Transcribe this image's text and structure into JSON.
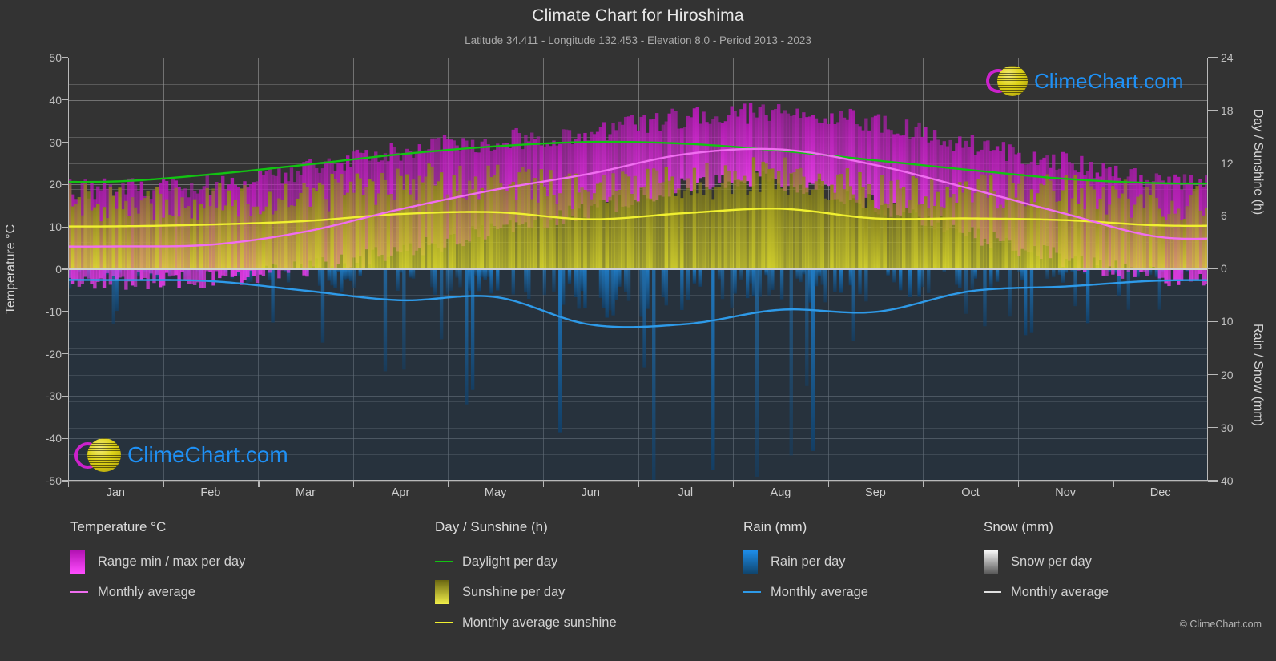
{
  "header": {
    "title": "Climate Chart for Hiroshima",
    "subtitle": "Latitude 34.411 - Longitude 132.453 - Elevation 8.0 - Period 2013 - 2023"
  },
  "branding": {
    "name": "ClimeChart.com",
    "copyright": "© ClimeChart.com",
    "ring_color": "#cc22cc",
    "ball_color": "#ded319",
    "text_color": "#1e90f5"
  },
  "axes": {
    "left_title": "Temperature °C",
    "right_title_top": "Day / Sunshine (h)",
    "right_title_bottom": "Rain / Snow (mm)",
    "left_ticks": [
      "50",
      "40",
      "30",
      "20",
      "10",
      "0",
      "-10",
      "-20",
      "-30",
      "-40",
      "-50"
    ],
    "right_ticks_top": [
      "24",
      "18",
      "12",
      "6",
      "0"
    ],
    "right_ticks_bottom": [
      "0",
      "10",
      "20",
      "30",
      "40"
    ],
    "x_ticks": [
      "Jan",
      "Feb",
      "Mar",
      "Apr",
      "May",
      "Jun",
      "Jul",
      "Aug",
      "Sep",
      "Oct",
      "Nov",
      "Dec"
    ]
  },
  "legend": {
    "groups": [
      {
        "title": "Temperature °C",
        "items": [
          {
            "label": "Range min / max per day",
            "type": "swatch",
            "color": "#e818e8"
          },
          {
            "label": "Monthly average",
            "type": "line",
            "color": "#f06ef0"
          }
        ]
      },
      {
        "title": "Day / Sunshine (h)",
        "items": [
          {
            "label": "Daylight per day",
            "type": "line",
            "color": "#12c312"
          },
          {
            "label": "Sunshine per day",
            "type": "swatch",
            "color": "#e8e830"
          },
          {
            "label": "Monthly average sunshine",
            "type": "line",
            "color": "#f0f030"
          }
        ]
      },
      {
        "title": "Rain (mm)",
        "items": [
          {
            "label": "Rain per day",
            "type": "swatch",
            "color": "#1a8ee8"
          },
          {
            "label": "Monthly average",
            "type": "line",
            "color": "#2e9ae8"
          }
        ]
      },
      {
        "title": "Snow (mm)",
        "items": [
          {
            "label": "Snow per day",
            "type": "swatch",
            "color": "#e8e8e8"
          },
          {
            "label": "Monthly average",
            "type": "line",
            "color": "#e0e0e0"
          }
        ]
      }
    ]
  },
  "chart_data": {
    "type": "line",
    "title": "Climate Chart for Hiroshima",
    "subtitle": "Latitude 34.411 - Longitude 132.453 - Elevation 8.0 - Period 2013 - 2023",
    "xlabel": "",
    "ylabel": "Temperature °C",
    "ylim": [
      -50,
      50
    ],
    "y2lim_top_hours": [
      0,
      24
    ],
    "y2lim_bottom_mm": [
      0,
      40
    ],
    "grid": true,
    "legend_position": "below",
    "categories": [
      "Jan",
      "Feb",
      "Mar",
      "Apr",
      "May",
      "Jun",
      "Jul",
      "Aug",
      "Sep",
      "Oct",
      "Nov",
      "Dec"
    ],
    "series": [
      {
        "name": "Monthly average temperature (°C)",
        "color": "#f06ef0",
        "unit": "°C",
        "axis": "left",
        "values": [
          5.4,
          5.8,
          8.9,
          14.2,
          18.8,
          22.6,
          27.2,
          28.3,
          24.6,
          19.0,
          13.1,
          7.6
        ]
      },
      {
        "name": "Daily max temperature envelope (°C)",
        "color": "#e818e8",
        "unit": "°C",
        "axis": "left",
        "values": [
          18.5,
          19.5,
          23.0,
          27.5,
          30.0,
          32.0,
          35.5,
          36.5,
          34.0,
          29.0,
          24.5,
          20.0
        ]
      },
      {
        "name": "Daily min temperature envelope (°C)",
        "color": "#e818e8",
        "unit": "°C",
        "axis": "left",
        "values": [
          -2.5,
          -2.0,
          0.5,
          4.5,
          9.5,
          14.5,
          20.0,
          21.0,
          15.5,
          8.5,
          2.5,
          -1.5
        ]
      },
      {
        "name": "Daylight per day (h)",
        "color": "#12c312",
        "unit": "h",
        "axis": "right-top",
        "values": [
          9.9,
          10.7,
          11.8,
          13.0,
          13.9,
          14.4,
          14.2,
          13.4,
          12.3,
          11.2,
          10.2,
          9.7
        ]
      },
      {
        "name": "Monthly average sunshine (h)",
        "color": "#f0f030",
        "unit": "h",
        "axis": "right-top",
        "values": [
          4.8,
          5.0,
          5.4,
          6.2,
          6.4,
          5.6,
          6.3,
          6.8,
          5.7,
          5.7,
          5.5,
          4.9
        ]
      },
      {
        "name": "Monthly average rain (mm/day)",
        "color": "#2e9ae8",
        "unit": "mm",
        "axis": "right-bottom",
        "values": [
          2.2,
          2.4,
          4.2,
          6.0,
          5.4,
          10.6,
          10.5,
          7.8,
          8.2,
          4.3,
          3.4,
          2.3
        ]
      }
    ]
  }
}
